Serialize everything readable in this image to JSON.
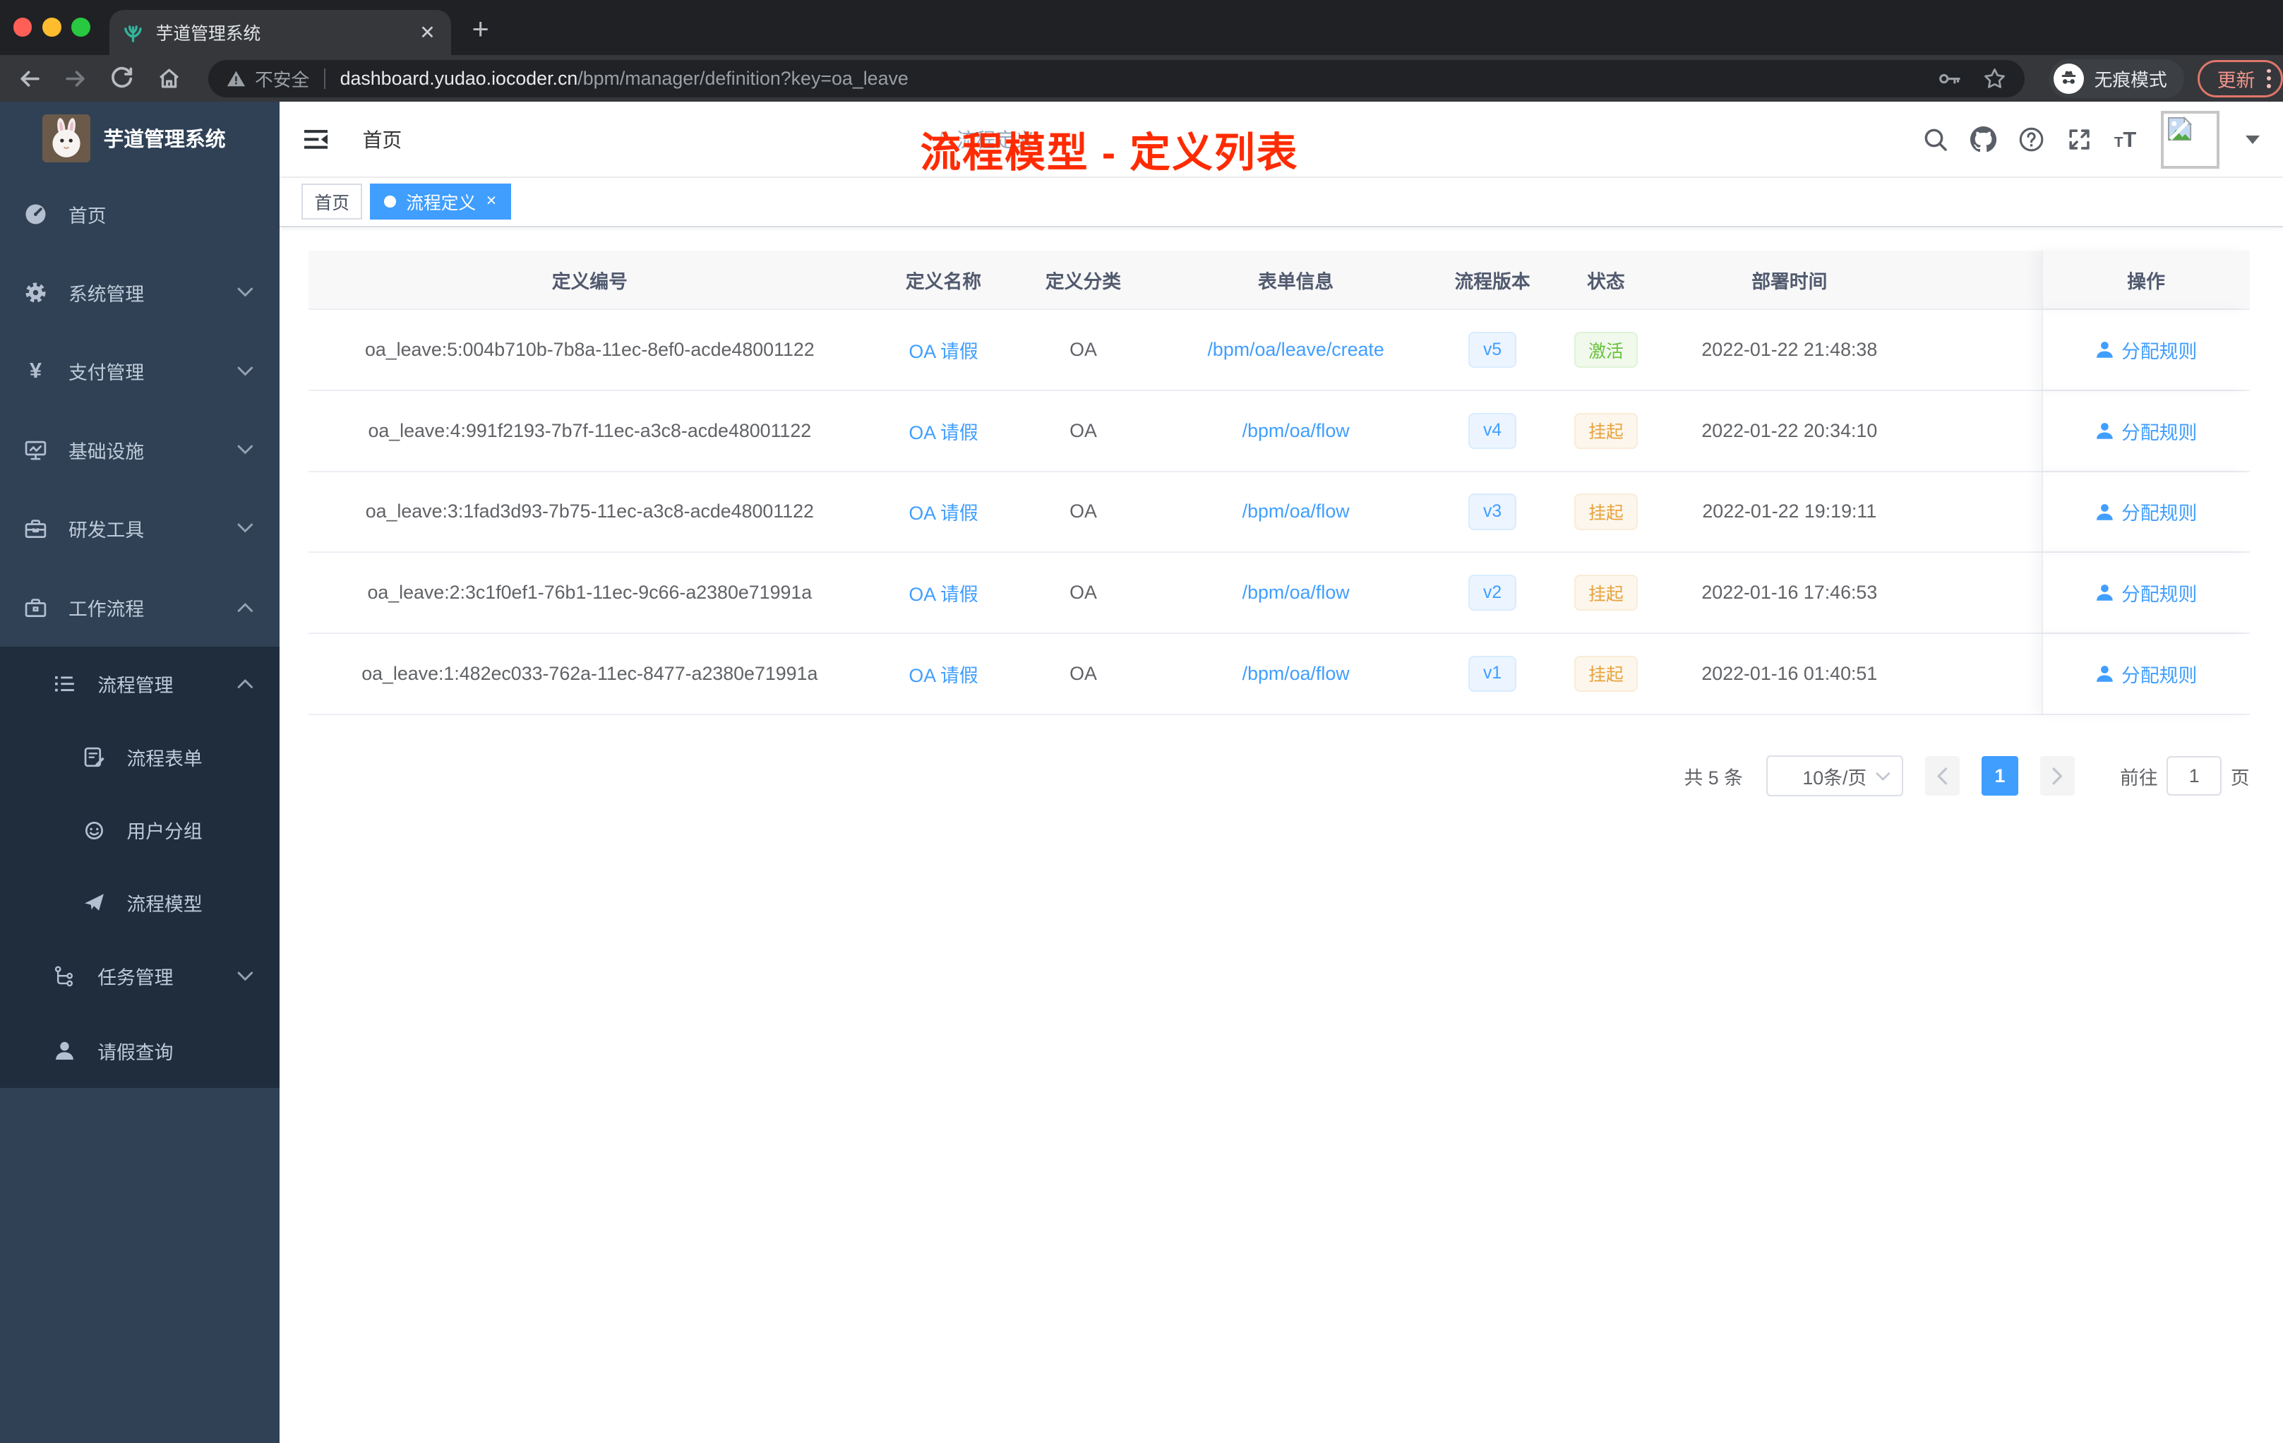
{
  "browser": {
    "tab_title": "芋道管理系统",
    "close_tab": "✕",
    "new_tab": "+",
    "security_label": "不安全",
    "url_host": "dashboard.yudao.iocoder.cn",
    "url_path": "/bpm/manager/definition?key=oa_leave",
    "incognito_label": "无痕模式",
    "update_label": "更新"
  },
  "sidebar": {
    "logo_title": "芋道管理系统",
    "items": [
      {
        "label": "首页",
        "icon": "dashboard-icon"
      },
      {
        "label": "系统管理",
        "icon": "gear-icon"
      },
      {
        "label": "支付管理",
        "icon": "yen-icon"
      },
      {
        "label": "基础设施",
        "icon": "monitor-icon"
      },
      {
        "label": "研发工具",
        "icon": "toolbox-icon"
      },
      {
        "label": "工作流程",
        "icon": "briefcase-icon"
      }
    ],
    "workflow_children": [
      {
        "label": "流程管理",
        "icon": "list-icon"
      },
      {
        "label": "流程表单",
        "icon": "form-icon"
      },
      {
        "label": "用户分组",
        "icon": "group-icon"
      },
      {
        "label": "流程模型",
        "icon": "send-icon"
      },
      {
        "label": "任务管理",
        "icon": "tree-icon"
      },
      {
        "label": "请假查询",
        "icon": "user-icon"
      }
    ]
  },
  "navbar": {
    "breadcrumb_home": "首页",
    "breadcrumb_sep": "/",
    "breadcrumb_current": "流程定义",
    "annotation": "流程模型 - 定义列表"
  },
  "tags": {
    "home": "首页",
    "active": "流程定义",
    "close": "×"
  },
  "table": {
    "columns": [
      "定义编号",
      "定义名称",
      "定义分类",
      "表单信息",
      "流程版本",
      "状态",
      "部署时间",
      "操作"
    ],
    "action_label": "分配规则",
    "rows": [
      {
        "id": "oa_leave:5:004b710b-7b8a-11ec-8ef0-acde48001122",
        "name": "OA 请假",
        "category": "OA",
        "form": "/bpm/oa/leave/create",
        "version": "v5",
        "status": "激活",
        "status_type": "success",
        "time": "2022-01-22 21:48:38"
      },
      {
        "id": "oa_leave:4:991f2193-7b7f-11ec-a3c8-acde48001122",
        "name": "OA 请假",
        "category": "OA",
        "form": "/bpm/oa/flow",
        "version": "v4",
        "status": "挂起",
        "status_type": "warning",
        "time": "2022-01-22 20:34:10"
      },
      {
        "id": "oa_leave:3:1fad3d93-7b75-11ec-a3c8-acde48001122",
        "name": "OA 请假",
        "category": "OA",
        "form": "/bpm/oa/flow",
        "version": "v3",
        "status": "挂起",
        "status_type": "warning",
        "time": "2022-01-22 19:19:11"
      },
      {
        "id": "oa_leave:2:3c1f0ef1-76b1-11ec-9c66-a2380e71991a",
        "name": "OA 请假",
        "category": "OA",
        "form": "/bpm/oa/flow",
        "version": "v2",
        "status": "挂起",
        "status_type": "warning",
        "time": "2022-01-16 17:46:53"
      },
      {
        "id": "oa_leave:1:482ec033-762a-11ec-8477-a2380e71991a",
        "name": "OA 请假",
        "category": "OA",
        "form": "/bpm/oa/flow",
        "version": "v1",
        "status": "挂起",
        "status_type": "warning",
        "time": "2022-01-16 01:40:51"
      }
    ]
  },
  "pagination": {
    "total": "共 5 条",
    "page_size": "10条/页",
    "page": "1",
    "go_prefix": "前往",
    "go_value": "1",
    "go_suffix": "页"
  },
  "colors": {
    "accent": "#409eff",
    "annotation_red": "#ff2b00",
    "status_active_green": "#67c23a",
    "status_suspend_orange": "#e6a23c",
    "sidebar_bg": "#304156",
    "submenu_bg": "#1f2d3d"
  }
}
